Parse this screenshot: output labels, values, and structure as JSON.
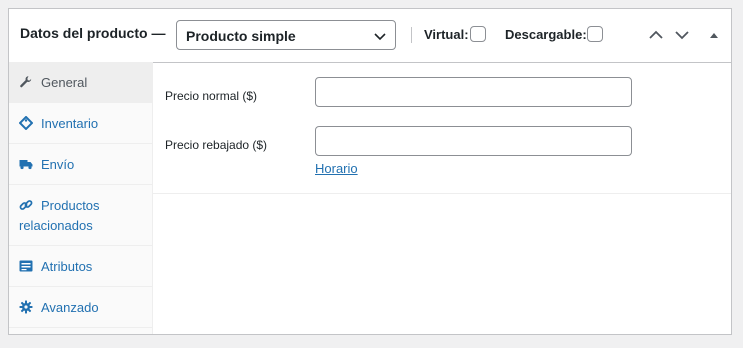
{
  "header": {
    "title": "Datos del producto —",
    "product_type": {
      "selected": "Producto simple"
    },
    "virtual_label": "Virtual:",
    "downloadable_label": "Descargable:"
  },
  "tabs": [
    {
      "label": "General",
      "icon": "wrench-icon",
      "active": true
    },
    {
      "label": "Inventario",
      "icon": "tag-icon"
    },
    {
      "label": "Envío",
      "icon": "truck-icon"
    },
    {
      "label_line1": "Productos",
      "label_line2": "relacionados",
      "icon": "link-icon"
    },
    {
      "label": "Atributos",
      "icon": "list-icon"
    },
    {
      "label": "Avanzado",
      "icon": "gear-icon"
    }
  ],
  "general": {
    "regular_price_label": "Precio normal ($)",
    "sale_price_label": "Precio rebajado ($)",
    "schedule_link": "Horario"
  },
  "colors": {
    "link": "#2271b1",
    "border": "#c3c4c7",
    "text": "#1d2327",
    "background": "#f0f0f1"
  }
}
